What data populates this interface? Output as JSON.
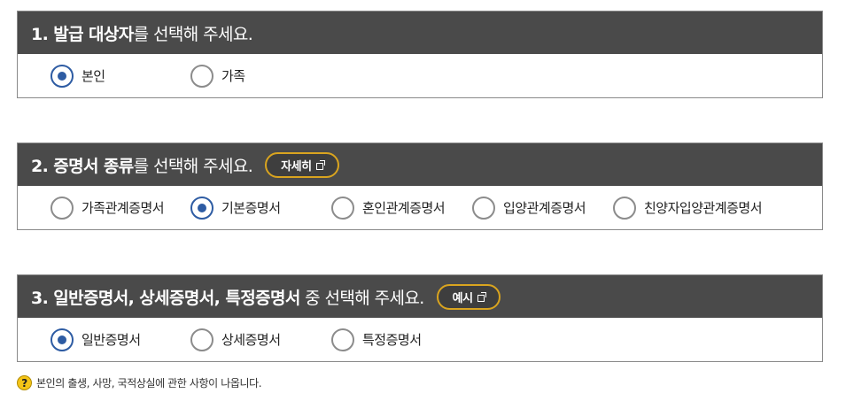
{
  "section1": {
    "title_bold": "1. 발급 대상자",
    "title_rest": "를 선택해 주세요.",
    "options": [
      "본인",
      "가족"
    ]
  },
  "section2": {
    "title_bold": "2. 증명서 종류",
    "title_rest": "를 선택해 주세요.",
    "detail_button": "자세히",
    "options": [
      "가족관계증명서",
      "기본증명서",
      "혼인관계증명서",
      "입양관계증명서",
      "친양자입양관계증명서"
    ]
  },
  "section3": {
    "title_bold": "3. 일반증명서, 상세증명서, 특정증명서",
    "title_rest": " 중 선택해 주세요.",
    "example_button": "예시",
    "options": [
      "일반증명서",
      "상세증명서",
      "특정증명서"
    ]
  },
  "note": {
    "icon": "question-icon",
    "text": "본인의 출생, 사망, 국적상실에 관한 사항이 나옵니다."
  },
  "colors": {
    "header_bg": "#4a4a4a",
    "radio_selected": "#2e5ca3",
    "button_border": "#d9a41f",
    "help_icon": "#f5c518"
  }
}
